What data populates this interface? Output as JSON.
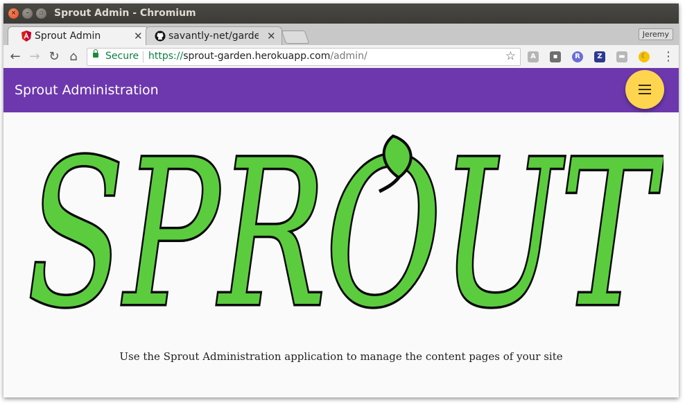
{
  "window": {
    "title": "Sprout Admin - Chromium"
  },
  "tabs": [
    {
      "label": "Sprout Admin",
      "favicon": "angular-icon"
    },
    {
      "label": "savantly-net/garde",
      "favicon": "github-icon"
    }
  ],
  "profile": {
    "name": "Jeremy"
  },
  "omnibox": {
    "secure_label": "Secure",
    "url_scheme": "https://",
    "url_host": "sprout-garden.herokuapp.com",
    "url_path": "/admin/"
  },
  "app": {
    "title": "Sprout Administration",
    "logo_text": "SPROUT",
    "tagline": "Use the Sprout Administration application to manage the content pages of your site"
  },
  "colors": {
    "appbar": "#6d38ad",
    "fab": "#ffd54f",
    "logo_fill": "#5ccc3f",
    "secure_green": "#0b8043"
  }
}
